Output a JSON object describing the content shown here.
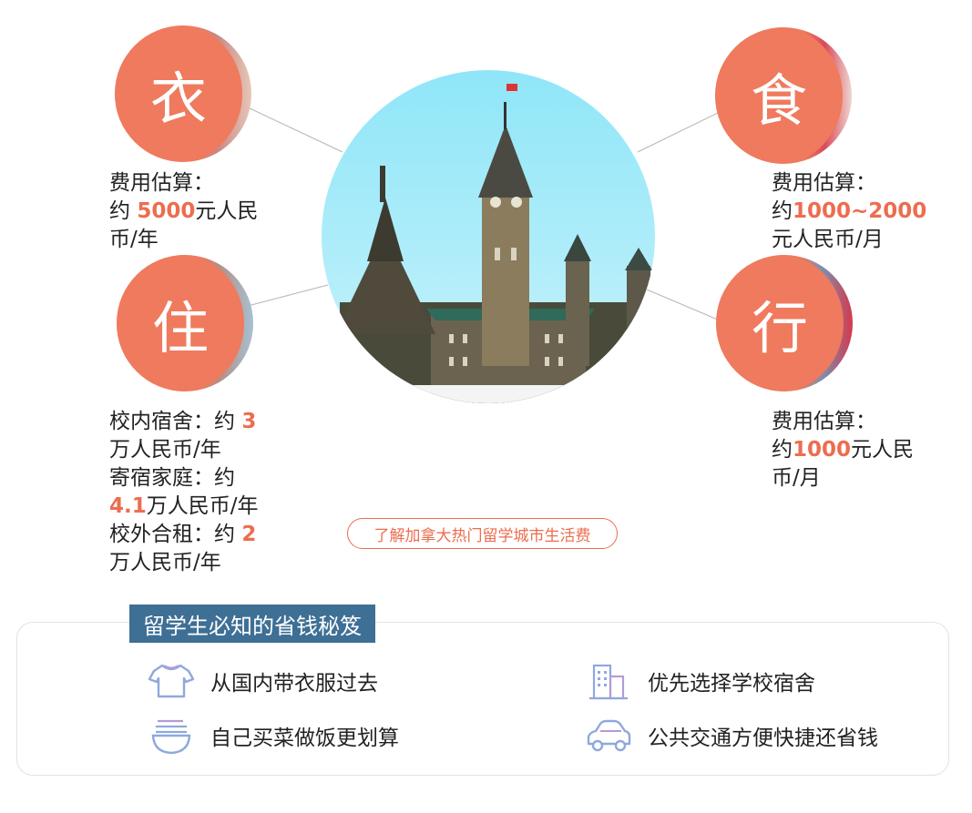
{
  "categories": {
    "clothing": {
      "char": "衣",
      "icon": "clothing-char-icon",
      "lines": [
        [
          {
            "t": "费用估算："
          }
        ],
        [
          {
            "t": "约 "
          },
          {
            "t": "5000",
            "hl": true
          },
          {
            "t": "元人民"
          }
        ],
        [
          {
            "t": "币/年"
          }
        ]
      ]
    },
    "food": {
      "char": "食",
      "icon": "food-char-icon",
      "lines": [
        [
          {
            "t": "费用估算："
          }
        ],
        [
          {
            "t": "约"
          },
          {
            "t": "1000~2000",
            "hl": true
          }
        ],
        [
          {
            "t": "元人民币/月"
          }
        ]
      ]
    },
    "housing": {
      "char": "住",
      "icon": "housing-char-icon",
      "lines": [
        [
          {
            "t": "校内宿舍：约 "
          },
          {
            "t": "3",
            "hl": true
          }
        ],
        [
          {
            "t": "万人民币/年"
          }
        ],
        [
          {
            "t": "寄宿家庭：约"
          }
        ],
        [
          {
            "t": "4.1",
            "hl": true
          },
          {
            "t": "万人民币/年"
          }
        ],
        [
          {
            "t": "校外合租：约 "
          },
          {
            "t": "2",
            "hl": true
          }
        ],
        [
          {
            "t": "万人民币/年"
          }
        ]
      ]
    },
    "transport": {
      "char": "行",
      "icon": "transport-char-icon",
      "lines": [
        [
          {
            "t": "费用估算："
          }
        ],
        [
          {
            "t": "约"
          },
          {
            "t": "1000",
            "hl": true
          },
          {
            "t": "元人民"
          }
        ],
        [
          {
            "t": "币/月"
          }
        ]
      ]
    }
  },
  "city_link": {
    "label": "了解加拿大热门留学城市生活费"
  },
  "tips": {
    "title": "留学生必知的省钱秘笈",
    "items": [
      {
        "label": "从国内带衣服过去",
        "icon": "tshirt-icon"
      },
      {
        "label": "优先选择学校宿舍",
        "icon": "building-icon"
      },
      {
        "label": "自己买菜做饭更划算",
        "icon": "noodle-bowl-icon"
      },
      {
        "label": "公共交通方便快捷还省钱",
        "icon": "car-icon"
      }
    ]
  },
  "colors": {
    "accent": "#ec6d4f",
    "circle": "#ef7a5e",
    "title_bar": "#3e6f95",
    "icon_stroke": "#8ea9dc"
  }
}
